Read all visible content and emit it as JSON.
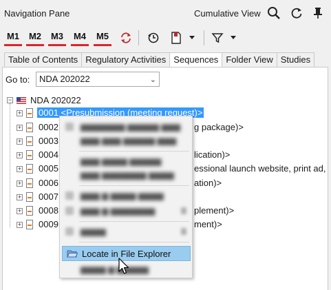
{
  "header": {
    "title": "Navigation Pane",
    "view_label": "Cumulative View"
  },
  "toolbar": {
    "m_buttons": [
      "M1",
      "M2",
      "M3",
      "M4",
      "M5"
    ]
  },
  "tabs": [
    "Table of Contents",
    "Regulatory Activities",
    "Sequences",
    "Folder View",
    "Studies"
  ],
  "active_tab": "Sequences",
  "goto": {
    "label": "Go to:",
    "value": "NDA 202022"
  },
  "tree": {
    "root": "NDA 202022",
    "rows": [
      "0001 <Presubmission (meeting request)>",
      "0002",
      "0003",
      "0004",
      "0005",
      "0006",
      "0007",
      "0008",
      "0009"
    ],
    "row_suffix_visible": {
      "0002": "g package)>",
      "0004": "lication)>",
      "0005": "essional launch website, print ad,",
      "0006": "ation)>",
      "0008": "plement)>",
      "0009": "ment)>"
    }
  },
  "context_menu": {
    "highlighted_item": "Locate in File Explorer"
  },
  "colors": {
    "selection": "#3399ff",
    "accent_red": "#d9262c",
    "menu_highlight": "#99ccee"
  }
}
